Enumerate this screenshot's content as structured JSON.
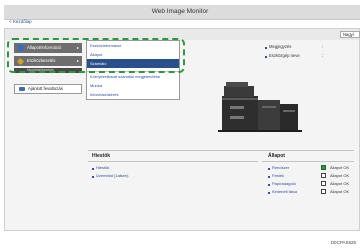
{
  "header": {
    "title": "Web Image Monitor"
  },
  "back_link": "< Kezdőlap",
  "top_button": "Nagyí",
  "nav": [
    {
      "label": "Állapot/Információ",
      "icon": "status-info-icon",
      "color": "#3a6cc0"
    },
    {
      "label": "Eszközkezelés",
      "icon": "device-management-icon",
      "color": "#d4a020"
    },
    {
      "label": "Nyomtatókezelés"
    }
  ],
  "user_tools": {
    "label": "Ajánlott fevaltozás"
  },
  "dropdown": {
    "items": [
      {
        "label": "Eszközinformáció",
        "selected": false
      },
      {
        "label": "Állapot",
        "selected": false
      },
      {
        "label": "Számláló",
        "selected": true
      },
      {
        "label": "Környezetbarát számláló megjelenítése",
        "selected": false
      },
      {
        "label": "Munka",
        "selected": false
      },
      {
        "label": "Információkérés",
        "selected": false
      }
    ]
  },
  "device_info": {
    "location_label": "Megjegyzés",
    "host_label": "Eszközgép neve",
    "sep": ":"
  },
  "toner": {
    "title": "Hiestök",
    "rows": [
      "Hiestök",
      "Üzemelat (1alsen)"
    ]
  },
  "status": {
    "title": "Állapot",
    "rows": [
      {
        "label": "Rendszer",
        "value": "Állapot OK"
      },
      {
        "label": "Festék",
        "value": "Állapot OK"
      },
      {
        "label": "Papírádagoló",
        "value": "Állapot OK"
      },
      {
        "label": "Kimeneti tálca",
        "value": "Állapot OK"
      }
    ]
  },
  "figure_code": "D0CPAS525"
}
